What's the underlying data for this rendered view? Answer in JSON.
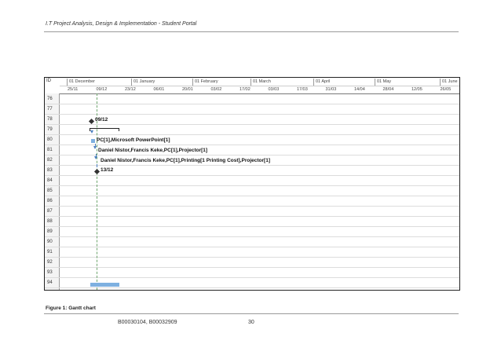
{
  "header": {
    "title": "I.T Project Analysis, Design & Implementation - Student Portal"
  },
  "gantt": {
    "id_header": "ID",
    "months": [
      "01 December",
      "01 January",
      "01 February",
      "01 March",
      "01 April",
      "01 May",
      "01 June"
    ],
    "weeks": [
      "25/11",
      "09/12",
      "23/12",
      "06/01",
      "20/01",
      "03/02",
      "17/02",
      "03/03",
      "17/03",
      "31/03",
      "14/04",
      "28/04",
      "12/05",
      "26/05"
    ],
    "row_ids": [
      "76",
      "77",
      "78",
      "79",
      "80",
      "81",
      "82",
      "83",
      "84",
      "85",
      "86",
      "87",
      "88",
      "89",
      "90",
      "91",
      "92",
      "93",
      "94"
    ],
    "labels": {
      "milestone_start": "09/12",
      "task_80": "PC[1],Microsoft PowerPoint[1]",
      "task_81": "Daniel Nistor,Francis Keke,PC[1],Projector[1]",
      "task_82": "Daniel Nistor,Francis Keke,PC[1],Printing[1 Printing Cost],Projector[1]",
      "milestone_end": "13/12"
    }
  },
  "caption": "Figure 1: Gantt chart",
  "footer": {
    "student_ids": "B00030104, B00032909",
    "page_number": "30"
  }
}
